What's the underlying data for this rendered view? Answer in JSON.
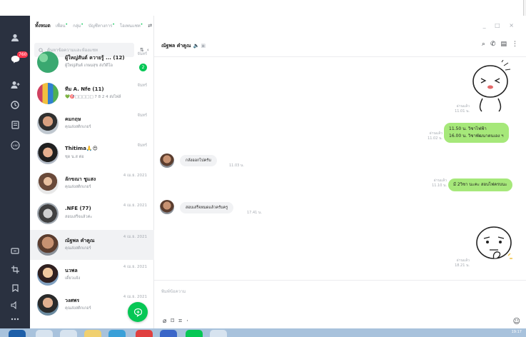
{
  "window": {
    "controls": "_ □ ×"
  },
  "tabs": [
    {
      "label": "ทั้งหมด",
      "active": true,
      "dot": false
    },
    {
      "label": "เพื่อน",
      "active": false,
      "dot": true
    },
    {
      "label": "กลุ่ม",
      "active": false,
      "dot": true
    },
    {
      "label": "บัญชีทางการ",
      "active": false,
      "dot": true
    },
    {
      "label": "โอเพนแชท",
      "active": false,
      "dot": true
    }
  ],
  "search": {
    "placeholder": "ค้นหาข้อความและห้องแชท"
  },
  "rail": {
    "badge": "760"
  },
  "chats": [
    {
      "name": "ผู้ใหญ่สันต์ ควายรู้ ... (12)",
      "sub": "ผู้ใหญ่สันต์ เกษมสุข ส่งวิดีโอ",
      "time": "จันทร์",
      "unread": "2",
      "selected": false
    },
    {
      "name": "ทีม A. Nfe (11)",
      "sub": "💚🎯□□□□□ 7 8 2 4 ส่งไฟล์",
      "time": "จันทร์",
      "unread": "",
      "selected": false
    },
    {
      "name": "คมกฤษ",
      "sub": "คุณส่งสติกเกอร์",
      "time": "จันทร์",
      "unread": "",
      "selected": false
    },
    {
      "name": "Thitima🙏😍",
      "sub": "ชุด น.ส ต่อ",
      "time": "จันทร์",
      "unread": "",
      "selected": false
    },
    {
      "name": "ลักขณา ชูแสง",
      "sub": "คุณส่งสติกเกอร์",
      "time": "4 เม.ย. 2021",
      "unread": "",
      "selected": false
    },
    {
      "name": ".NFE (77)",
      "sub": "สอบเสร็จแล้วค่ะ",
      "time": "4 เม.ย. 2021",
      "unread": "",
      "selected": false
    },
    {
      "name": "ณัฐพล คำคูณ",
      "sub": "คุณส่งสติกเกอร์",
      "time": "4 เม.ย. 2021",
      "unread": "",
      "selected": true
    },
    {
      "name": "นวพล",
      "sub": "เดี๋ยวแจ้ง",
      "time": "4 เม.ย. 2021",
      "unread": "",
      "selected": false
    },
    {
      "name": "วงศพร",
      "sub": "คุณส่งสติกเกอร์",
      "time": "4 เม.ย. 2021",
      "unread": "",
      "selected": false
    }
  ],
  "chat": {
    "title": "ณัฐพล คำคูณ",
    "read_label": "อ่านแล้ว",
    "messages": {
      "sticker1_time": "11.01 น.",
      "m1_line1": "11.50 น.  วิชาไฟฟ้า",
      "m1_line2": "16.00 น.  วิชาพัฒนาตนเอง ฯ",
      "m1_time": "11.02 น.",
      "r1_text": "กลังออกไปครับ",
      "r1_time": "11.03 น.",
      "m2_text": "มี 2วิชา นะคะ สอบไฟครบนะ",
      "m2_time": "11.10 น.",
      "r2_text": "สอบเสร็จหมดแล้วครับครู",
      "r2_time": "17.41 น.",
      "sticker2_time": "18.21 น."
    },
    "input_placeholder": "พิมพ์ข้อความ"
  },
  "taskbar": {
    "clock": "19:17"
  },
  "colors": {
    "accent": "#06c755",
    "rail": "#2a3140",
    "my_bubble": "#a6e87a",
    "badge": "#ff334b"
  }
}
